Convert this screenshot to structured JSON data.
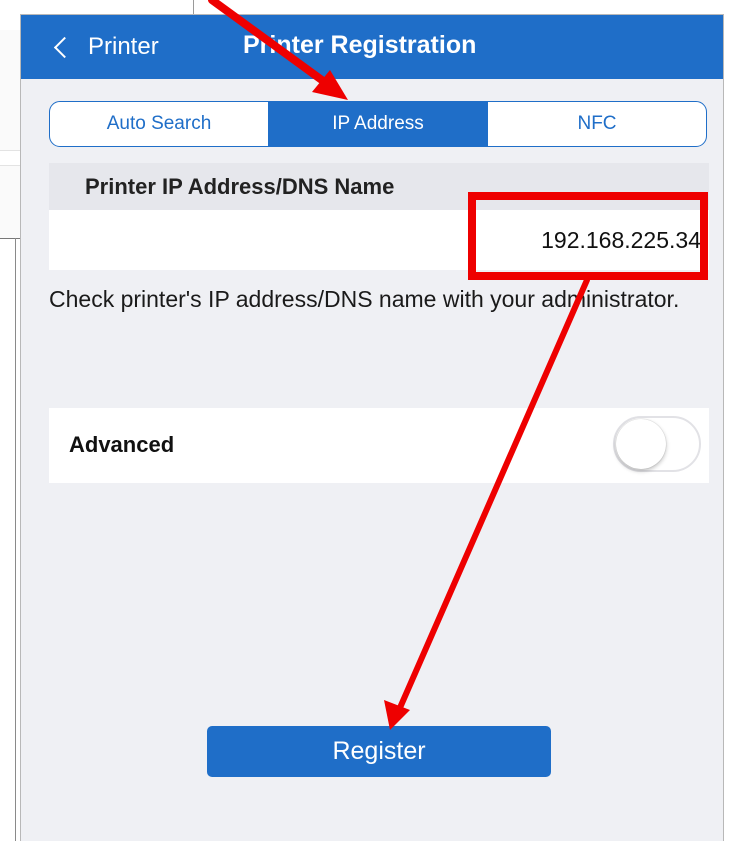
{
  "nav": {
    "back_label": "Printer",
    "title": "Printer Registration"
  },
  "tabs": [
    {
      "label": "Auto Search",
      "active": false
    },
    {
      "label": "IP Address",
      "active": true
    },
    {
      "label": "NFC",
      "active": false
    }
  ],
  "ip_section": {
    "header": "Printer IP Address/DNS Name",
    "value": "192.168.225.34",
    "helper": "Check printer's IP address/DNS name with your administrator."
  },
  "advanced": {
    "label": "Advanced",
    "enabled": false
  },
  "register_label": "Register",
  "colors": {
    "accent": "#1f6ec8",
    "background": "#eff0f4",
    "annotation": "#ee0000"
  },
  "icons": {
    "back": "chevron-left-icon",
    "toggle": "toggle-switch"
  }
}
